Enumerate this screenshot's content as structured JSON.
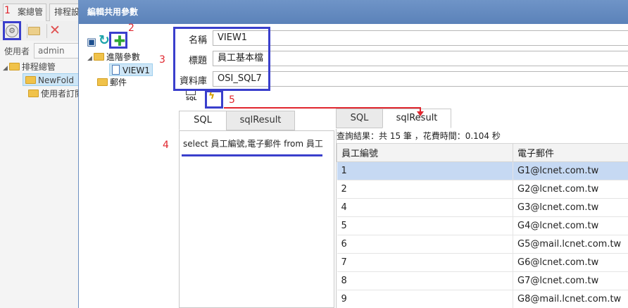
{
  "background_app": {
    "tabs": [
      "案總管",
      "排程設"
    ],
    "user_label": "使用者",
    "user_value": "admin",
    "tree": {
      "root": "排程總管",
      "items": [
        "NewFold",
        "使用者訂閱"
      ]
    }
  },
  "dialog": {
    "title": "編輯共用參數",
    "tree": {
      "items": [
        {
          "label": "進階參數",
          "icon": "folder-icon"
        },
        {
          "label": "VIEW1",
          "icon": "file-icon"
        },
        {
          "label": "郵件",
          "icon": "folder-icon"
        }
      ]
    },
    "form": {
      "name_label": "名稱",
      "name_value": "VIEW1",
      "title_label": "標題",
      "title_value": "員工基本檔",
      "db_label": "資料庫",
      "db_value": "OSI_SQL7"
    },
    "mini_tools": {
      "sql_icon_label": "SQL"
    },
    "editor_tabs": [
      "SQL",
      "sqlResult"
    ],
    "sql_text": "select 員工編號,電子郵件 from 員工",
    "result_tabs": [
      "SQL",
      "sqlResult"
    ],
    "result_summary": "查詢結果：共 15 筆 ，花費時間：0.104 秒",
    "columns": [
      "員工編號",
      "電子郵件"
    ],
    "rows": [
      [
        "1",
        "G1@lcnet.com.tw"
      ],
      [
        "2",
        "G2@lcnet.com.tw"
      ],
      [
        "4",
        "G3@lcnet.com.tw"
      ],
      [
        "5",
        "G4@lcnet.com.tw"
      ],
      [
        "6",
        "G5@mail.lcnet.com.tw"
      ],
      [
        "7",
        "G6@lcnet.com.tw"
      ],
      [
        "8",
        "G7@lcnet.com.tw"
      ],
      [
        "9",
        "G8@mail.lcnet.com.tw"
      ]
    ]
  },
  "annotations": [
    "1",
    "2",
    "3",
    "4",
    "5"
  ],
  "colors": {
    "title_bar": "#5b82b9",
    "annotation_box": "#3a3fcc",
    "annotation_number": "#e0262e",
    "selected_row": "#c6d9f3"
  }
}
